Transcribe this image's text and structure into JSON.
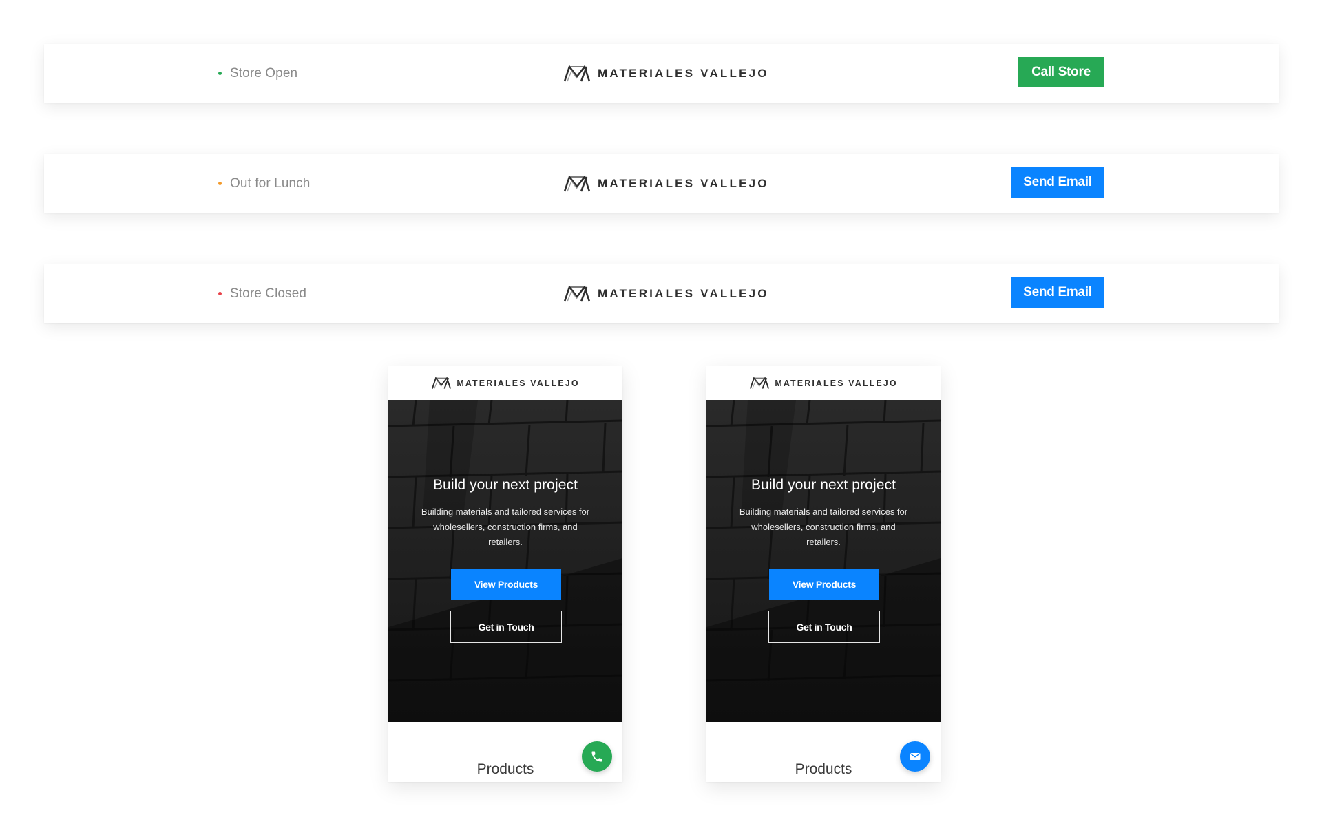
{
  "brand": {
    "name": "MATERIALES VALLEJO",
    "logo_icon": "mv-logo-icon"
  },
  "desktop_headers": [
    {
      "status_text": "Store Open",
      "status_color": "#27a955",
      "cta_label": "Call Store",
      "cta_color": "#27a955"
    },
    {
      "status_text": "Out for Lunch",
      "status_color": "#f39a2b",
      "cta_label": "Send Email",
      "cta_color": "#0a84ff"
    },
    {
      "status_text": "Store Closed",
      "status_color": "#e8424a",
      "cta_label": "Send Email",
      "cta_color": "#0a84ff"
    }
  ],
  "mobile_previews": [
    {
      "hero_title": "Build your next project",
      "hero_subtitle": "Building materials and tailored services for wholesellers, construction firms, and retailers.",
      "primary_button": "View Products",
      "secondary_button": "Get in Touch",
      "section_title": "Products",
      "fab_icon": "phone-icon",
      "fab_color": "#27a955"
    },
    {
      "hero_title": "Build your next project",
      "hero_subtitle": "Building materials and tailored services for wholesellers, construction firms, and retailers.",
      "primary_button": "View Products",
      "secondary_button": "Get in Touch",
      "section_title": "Products",
      "fab_icon": "envelope-icon",
      "fab_color": "#0a84ff"
    }
  ]
}
